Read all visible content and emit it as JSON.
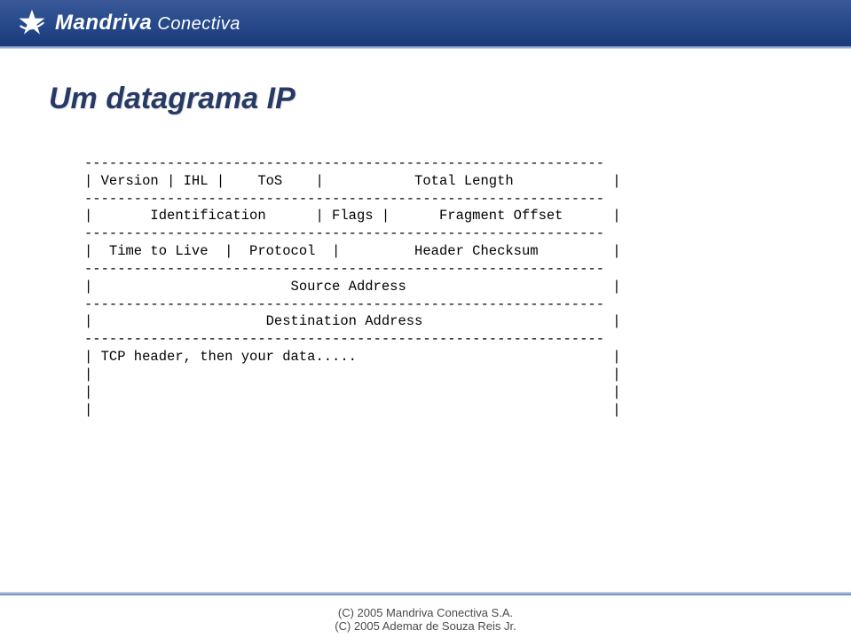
{
  "header": {
    "brand_main": "Mandriva",
    "brand_sub": "Conectiva"
  },
  "slide": {
    "title": "Um datagrama IP",
    "diagram": {
      "sep": "---------------------------------------------------------------",
      "row1": "| Version | IHL |    ToS    |           Total Length            |",
      "row2": "|       Identification      | Flags |      Fragment Offset      |",
      "row3": "|  Time to Live  |  Protocol  |         Header Checksum         |",
      "row4": "|                        Source Address                         |",
      "row5": "|                     Destination Address                       |",
      "row6": "| TCP header, then your data.....                               |",
      "empty": "|                                                               |"
    }
  },
  "footer": {
    "line1": "(C) 2005 Mandriva Conectiva S.A.",
    "line2": "(C) 2005 Ademar de Souza Reis Jr."
  }
}
